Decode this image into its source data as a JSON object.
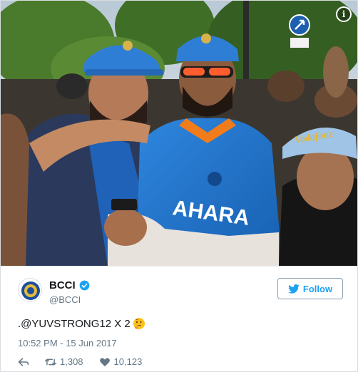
{
  "photo": {
    "jersey_text": "AHARA"
  },
  "account": {
    "name": "BCCI",
    "handle": "@BCCI"
  },
  "follow": {
    "label": "Follow"
  },
  "tweet": {
    "text": ".@YUVSTRONG12 X 2",
    "emoji": "thinking-face",
    "timestamp": "10:52 PM - 15 Jun 2017"
  },
  "stats": {
    "retweets": "1,308",
    "likes": "10,123"
  },
  "colors": {
    "twitter_blue": "#1da1f2",
    "india_blue": "#1f6fc2",
    "text_grey": "#657786"
  }
}
